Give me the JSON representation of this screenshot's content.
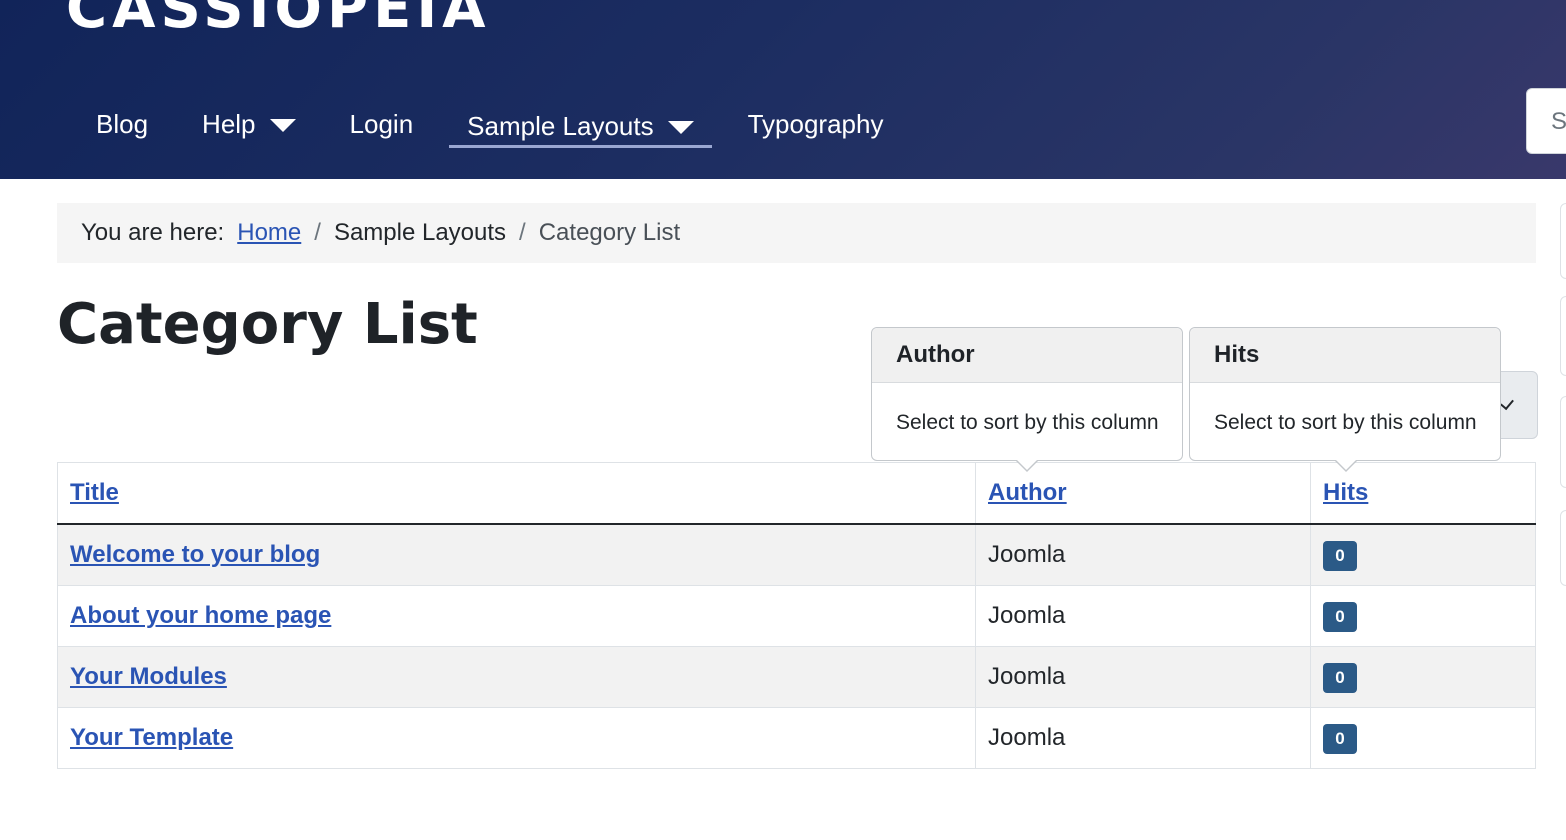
{
  "header": {
    "brand": "CASSIOPEIA",
    "nav": [
      {
        "label": "Blog"
      },
      {
        "label": "Help"
      },
      {
        "label": "Login"
      },
      {
        "label": "Sample Layouts"
      },
      {
        "label": "Typography"
      }
    ],
    "search_placeholder": "Se"
  },
  "breadcrumb": {
    "prefix": "You are here:",
    "items": [
      "Home",
      "Sample Layouts",
      "Category List"
    ],
    "separator": "/"
  },
  "page_title": "Category List",
  "tooltips": [
    {
      "title": "Author",
      "text": "Select to sort by this column"
    },
    {
      "title": "Hits",
      "text": "Select to sort by this column"
    }
  ],
  "table": {
    "headers": [
      "Title",
      "Author",
      "Hits"
    ],
    "rows": [
      {
        "title": "Welcome to your blog",
        "author": "Joomla",
        "hits": "0"
      },
      {
        "title": "About your home page",
        "author": "Joomla",
        "hits": "0"
      },
      {
        "title": "Your Modules",
        "author": "Joomla",
        "hits": "0"
      },
      {
        "title": "Your Template",
        "author": "Joomla",
        "hits": "0"
      }
    ]
  },
  "colors": {
    "header_bg": "#1c2d61",
    "link": "#2a54b4",
    "badge": "#2b5a87"
  }
}
